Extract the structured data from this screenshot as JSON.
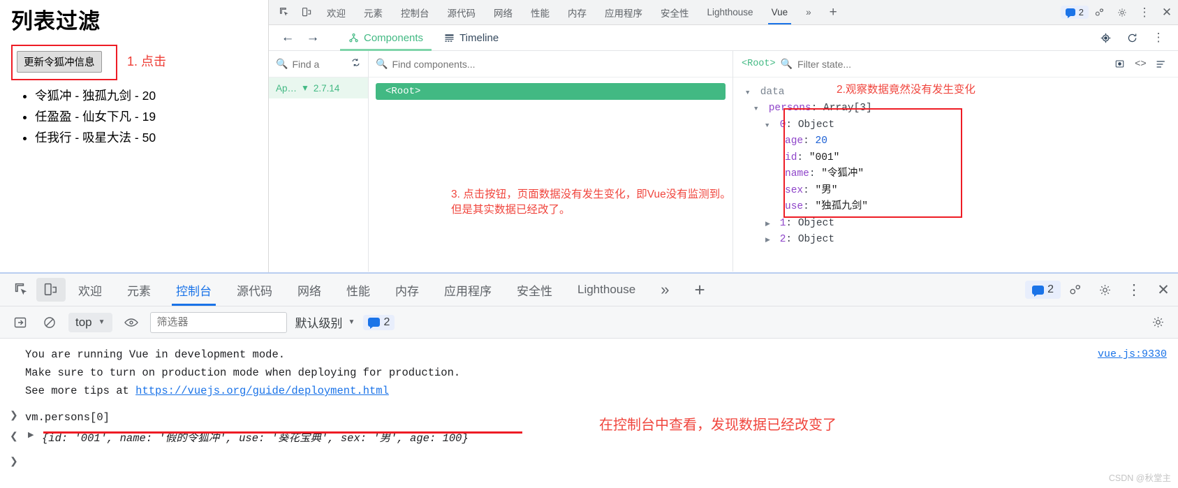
{
  "page": {
    "title": "列表过滤",
    "update_button": "更新令狐冲信息",
    "annotation_1": "1. 点击",
    "persons": [
      "令狐冲 - 独孤九剑 - 20",
      "任盈盈 - 仙女下凡 - 19",
      "任我行 - 吸星大法 - 50"
    ]
  },
  "devtools_top": {
    "tabs": [
      "欢迎",
      "元素",
      "控制台",
      "源代码",
      "网络",
      "性能",
      "内存",
      "应用程序",
      "安全性",
      "Lighthouse",
      "Vue"
    ],
    "selected_tab": "Vue",
    "more_tabs": "»",
    "add_tab": "+",
    "warning_count": "2",
    "icons": [
      "inspect-element-icon",
      "device-toolbar-icon",
      "more-tabs-icon",
      "add-panel-icon",
      "issues-icon",
      "devtools-settings-icon",
      "more-options-icon",
      "close-devtools-icon"
    ]
  },
  "vue_devtools": {
    "back": "←",
    "forward": "→",
    "tabs": [
      {
        "label": "Components",
        "selected": true
      },
      {
        "label": "Timeline",
        "selected": false
      }
    ],
    "app_search_placeholder": "Find a",
    "component_search_placeholder": "Find components...",
    "app_name": "Ap…",
    "vue_version": "2.7.14",
    "root_component": "<Root>",
    "state_scope": "<Root>",
    "state_filter_placeholder": "Filter state...",
    "data_label": "data",
    "tree": [
      {
        "indent": 0,
        "arrow": "open",
        "key": "persons",
        "sep": ": ",
        "value": "Array[3]",
        "key_color": "purple",
        "value_color": "dark"
      },
      {
        "indent": 1,
        "arrow": "open",
        "key": "0",
        "sep": ": ",
        "value": "Object",
        "key_color": "purple",
        "value_color": "dark"
      },
      {
        "indent": 2,
        "arrow": "none",
        "key": "age",
        "sep": ": ",
        "value": "20",
        "key_color": "purple",
        "value_color": "num"
      },
      {
        "indent": 2,
        "arrow": "none",
        "key": "id",
        "sep": ": ",
        "value": "\"001\"",
        "key_color": "purple",
        "value_color": "str"
      },
      {
        "indent": 2,
        "arrow": "none",
        "key": "name",
        "sep": ": ",
        "value": "\"令狐冲\"",
        "key_color": "purple",
        "value_color": "str"
      },
      {
        "indent": 2,
        "arrow": "none",
        "key": "sex",
        "sep": ": ",
        "value": "\"男\"",
        "key_color": "purple",
        "value_color": "str"
      },
      {
        "indent": 2,
        "arrow": "none",
        "key": "use",
        "sep": ": ",
        "value": "\"独孤九剑\"",
        "key_color": "purple",
        "value_color": "str"
      },
      {
        "indent": 1,
        "arrow": "closed",
        "key": "1",
        "sep": ": ",
        "value": "Object",
        "key_color": "purple",
        "value_color": "dark"
      },
      {
        "indent": 1,
        "arrow": "closed",
        "key": "2",
        "sep": ": ",
        "value": "Object",
        "key_color": "purple",
        "value_color": "dark"
      }
    ],
    "annotation_2": "2.观察数据竟然没有发生变化",
    "annotation_3_line1": "3. 点击按钮，页面数据没有发生变化，即Vue没有监测到。",
    "annotation_3_line2": "但是其实数据已经改了。"
  },
  "console_panel": {
    "tabs": [
      "欢迎",
      "元素",
      "控制台",
      "源代码",
      "网络",
      "性能",
      "内存",
      "应用程序",
      "安全性",
      "Lighthouse"
    ],
    "selected_tab": "控制台",
    "more_tabs": "»",
    "add_tab": "+",
    "warning_count": "2",
    "context": "top",
    "filter_placeholder": "筛选器",
    "level": "默认级别",
    "level_badge": "2",
    "messages": [
      {
        "type": "warn-text",
        "text": "You are running Vue in development mode.",
        "source": "vue.js:9330"
      },
      {
        "type": "warn-text",
        "text": "Make sure to turn on production mode when deploying for production."
      },
      {
        "type": "warn-link",
        "prefix": "See more tips at ",
        "link": "https://vuejs.org/guide/deployment.html"
      }
    ],
    "input_line": "vm.persons[0]",
    "result_line": "{id: '001', name: '假的令狐冲', use: '葵花宝典', sex: '男', age: 100}",
    "annotation_4": "在控制台中查看，发现数据已经改变了",
    "watermark": "CSDN @秋堂主"
  }
}
